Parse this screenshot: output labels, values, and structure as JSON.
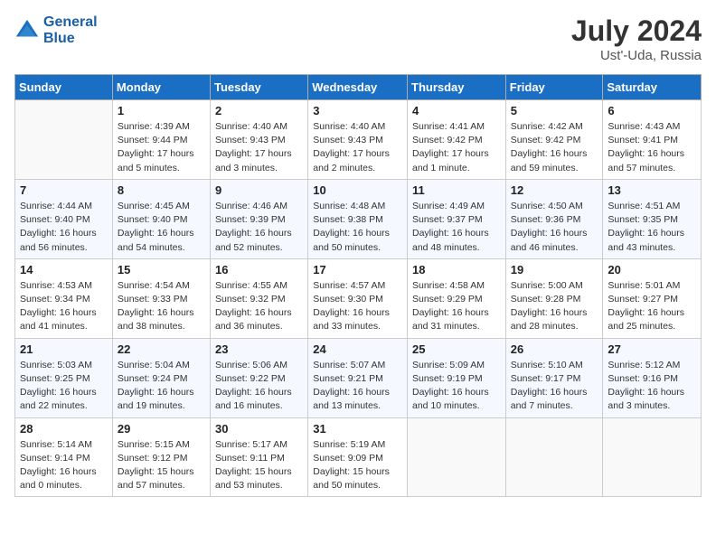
{
  "header": {
    "logo_line1": "General",
    "logo_line2": "Blue",
    "month_year": "July 2024",
    "location": "Ust'-Uda, Russia"
  },
  "columns": [
    "Sunday",
    "Monday",
    "Tuesday",
    "Wednesday",
    "Thursday",
    "Friday",
    "Saturday"
  ],
  "weeks": [
    [
      {
        "day": "",
        "sunrise": "",
        "sunset": "",
        "daylight": ""
      },
      {
        "day": "1",
        "sunrise": "Sunrise: 4:39 AM",
        "sunset": "Sunset: 9:44 PM",
        "daylight": "Daylight: 17 hours and 5 minutes."
      },
      {
        "day": "2",
        "sunrise": "Sunrise: 4:40 AM",
        "sunset": "Sunset: 9:43 PM",
        "daylight": "Daylight: 17 hours and 3 minutes."
      },
      {
        "day": "3",
        "sunrise": "Sunrise: 4:40 AM",
        "sunset": "Sunset: 9:43 PM",
        "daylight": "Daylight: 17 hours and 2 minutes."
      },
      {
        "day": "4",
        "sunrise": "Sunrise: 4:41 AM",
        "sunset": "Sunset: 9:42 PM",
        "daylight": "Daylight: 17 hours and 1 minute."
      },
      {
        "day": "5",
        "sunrise": "Sunrise: 4:42 AM",
        "sunset": "Sunset: 9:42 PM",
        "daylight": "Daylight: 16 hours and 59 minutes."
      },
      {
        "day": "6",
        "sunrise": "Sunrise: 4:43 AM",
        "sunset": "Sunset: 9:41 PM",
        "daylight": "Daylight: 16 hours and 57 minutes."
      }
    ],
    [
      {
        "day": "7",
        "sunrise": "Sunrise: 4:44 AM",
        "sunset": "Sunset: 9:40 PM",
        "daylight": "Daylight: 16 hours and 56 minutes."
      },
      {
        "day": "8",
        "sunrise": "Sunrise: 4:45 AM",
        "sunset": "Sunset: 9:40 PM",
        "daylight": "Daylight: 16 hours and 54 minutes."
      },
      {
        "day": "9",
        "sunrise": "Sunrise: 4:46 AM",
        "sunset": "Sunset: 9:39 PM",
        "daylight": "Daylight: 16 hours and 52 minutes."
      },
      {
        "day": "10",
        "sunrise": "Sunrise: 4:48 AM",
        "sunset": "Sunset: 9:38 PM",
        "daylight": "Daylight: 16 hours and 50 minutes."
      },
      {
        "day": "11",
        "sunrise": "Sunrise: 4:49 AM",
        "sunset": "Sunset: 9:37 PM",
        "daylight": "Daylight: 16 hours and 48 minutes."
      },
      {
        "day": "12",
        "sunrise": "Sunrise: 4:50 AM",
        "sunset": "Sunset: 9:36 PM",
        "daylight": "Daylight: 16 hours and 46 minutes."
      },
      {
        "day": "13",
        "sunrise": "Sunrise: 4:51 AM",
        "sunset": "Sunset: 9:35 PM",
        "daylight": "Daylight: 16 hours and 43 minutes."
      }
    ],
    [
      {
        "day": "14",
        "sunrise": "Sunrise: 4:53 AM",
        "sunset": "Sunset: 9:34 PM",
        "daylight": "Daylight: 16 hours and 41 minutes."
      },
      {
        "day": "15",
        "sunrise": "Sunrise: 4:54 AM",
        "sunset": "Sunset: 9:33 PM",
        "daylight": "Daylight: 16 hours and 38 minutes."
      },
      {
        "day": "16",
        "sunrise": "Sunrise: 4:55 AM",
        "sunset": "Sunset: 9:32 PM",
        "daylight": "Daylight: 16 hours and 36 minutes."
      },
      {
        "day": "17",
        "sunrise": "Sunrise: 4:57 AM",
        "sunset": "Sunset: 9:30 PM",
        "daylight": "Daylight: 16 hours and 33 minutes."
      },
      {
        "day": "18",
        "sunrise": "Sunrise: 4:58 AM",
        "sunset": "Sunset: 9:29 PM",
        "daylight": "Daylight: 16 hours and 31 minutes."
      },
      {
        "day": "19",
        "sunrise": "Sunrise: 5:00 AM",
        "sunset": "Sunset: 9:28 PM",
        "daylight": "Daylight: 16 hours and 28 minutes."
      },
      {
        "day": "20",
        "sunrise": "Sunrise: 5:01 AM",
        "sunset": "Sunset: 9:27 PM",
        "daylight": "Daylight: 16 hours and 25 minutes."
      }
    ],
    [
      {
        "day": "21",
        "sunrise": "Sunrise: 5:03 AM",
        "sunset": "Sunset: 9:25 PM",
        "daylight": "Daylight: 16 hours and 22 minutes."
      },
      {
        "day": "22",
        "sunrise": "Sunrise: 5:04 AM",
        "sunset": "Sunset: 9:24 PM",
        "daylight": "Daylight: 16 hours and 19 minutes."
      },
      {
        "day": "23",
        "sunrise": "Sunrise: 5:06 AM",
        "sunset": "Sunset: 9:22 PM",
        "daylight": "Daylight: 16 hours and 16 minutes."
      },
      {
        "day": "24",
        "sunrise": "Sunrise: 5:07 AM",
        "sunset": "Sunset: 9:21 PM",
        "daylight": "Daylight: 16 hours and 13 minutes."
      },
      {
        "day": "25",
        "sunrise": "Sunrise: 5:09 AM",
        "sunset": "Sunset: 9:19 PM",
        "daylight": "Daylight: 16 hours and 10 minutes."
      },
      {
        "day": "26",
        "sunrise": "Sunrise: 5:10 AM",
        "sunset": "Sunset: 9:17 PM",
        "daylight": "Daylight: 16 hours and 7 minutes."
      },
      {
        "day": "27",
        "sunrise": "Sunrise: 5:12 AM",
        "sunset": "Sunset: 9:16 PM",
        "daylight": "Daylight: 16 hours and 3 minutes."
      }
    ],
    [
      {
        "day": "28",
        "sunrise": "Sunrise: 5:14 AM",
        "sunset": "Sunset: 9:14 PM",
        "daylight": "Daylight: 16 hours and 0 minutes."
      },
      {
        "day": "29",
        "sunrise": "Sunrise: 5:15 AM",
        "sunset": "Sunset: 9:12 PM",
        "daylight": "Daylight: 15 hours and 57 minutes."
      },
      {
        "day": "30",
        "sunrise": "Sunrise: 5:17 AM",
        "sunset": "Sunset: 9:11 PM",
        "daylight": "Daylight: 15 hours and 53 minutes."
      },
      {
        "day": "31",
        "sunrise": "Sunrise: 5:19 AM",
        "sunset": "Sunset: 9:09 PM",
        "daylight": "Daylight: 15 hours and 50 minutes."
      },
      {
        "day": "",
        "sunrise": "",
        "sunset": "",
        "daylight": ""
      },
      {
        "day": "",
        "sunrise": "",
        "sunset": "",
        "daylight": ""
      },
      {
        "day": "",
        "sunrise": "",
        "sunset": "",
        "daylight": ""
      }
    ]
  ]
}
